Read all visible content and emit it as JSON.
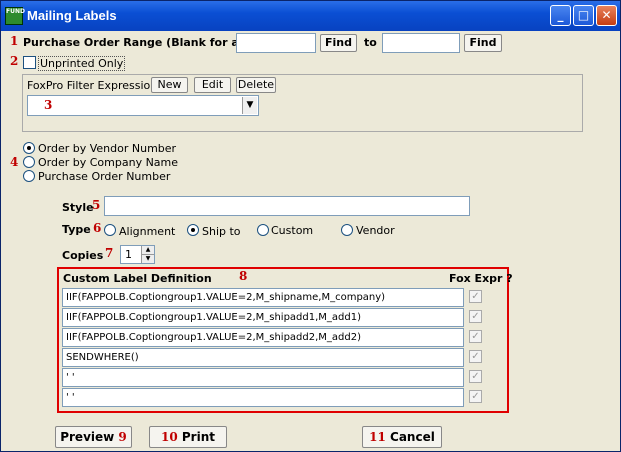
{
  "window": {
    "title": "Mailing Labels",
    "icon_text": "FUND",
    "minimize": "_",
    "maximize": "□",
    "close": "✕"
  },
  "numbers": {
    "n1": "1",
    "n2": "2",
    "n3": "3",
    "n4": "4",
    "n5": "5",
    "n6": "6",
    "n7": "7",
    "n8": "8",
    "n9": "9",
    "n10": "10",
    "n11": "11"
  },
  "po": {
    "label": "Purchase Order Range (Blank for all)",
    "from_value": "",
    "to_value": "",
    "find1": "Find",
    "to_label": "to",
    "find2": "Find"
  },
  "unprinted": {
    "label": "Unprinted Only",
    "checked": false
  },
  "filter": {
    "label": "FoxPro Filter Expression",
    "new": "New",
    "edit": "Edit",
    "delete": "Delete",
    "value": ""
  },
  "order": {
    "options": [
      "Order by Vendor Number",
      "Order by Company Name",
      "Purchase Order Number"
    ],
    "selected": 0
  },
  "style": {
    "label": "Style",
    "value": ""
  },
  "type": {
    "label": "Type",
    "options": [
      "Alignment",
      "Ship to",
      "Custom",
      "Vendor"
    ],
    "selected": 1
  },
  "copies": {
    "label": "Copies",
    "value": "1"
  },
  "custom": {
    "label": "Custom Label Definition",
    "fox_label": "Fox Expr ?",
    "rows": [
      "IIF(FAPPOLB.Coptiongroup1.VALUE=2,M_shipname,M_company)",
      "IIF(FAPPOLB.Coptiongroup1.VALUE=2,M_shipadd1,M_add1)",
      "IIF(FAPPOLB.Coptiongroup1.VALUE=2,M_shipadd2,M_add2)",
      "SENDWHERE()",
      "' '",
      "' '"
    ]
  },
  "buttons": {
    "preview": "Preview",
    "print": "Print",
    "cancel": "Cancel"
  }
}
